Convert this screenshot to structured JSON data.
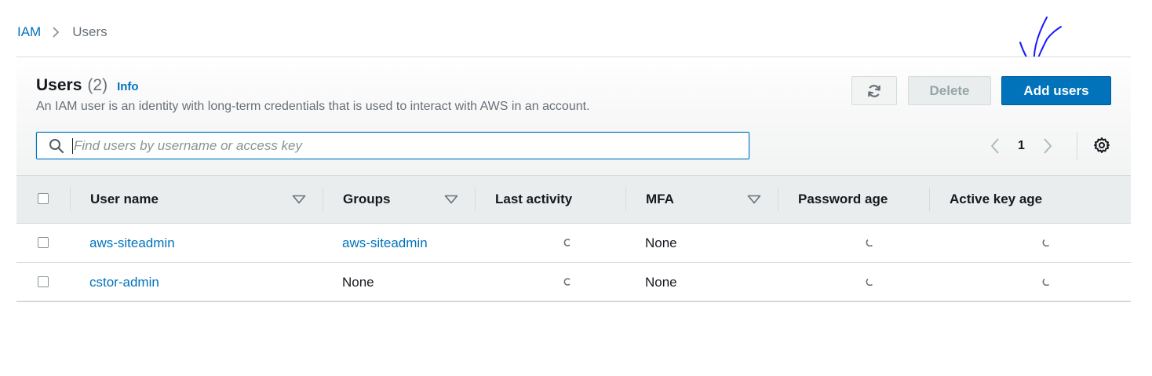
{
  "breadcrumb": {
    "root": "IAM",
    "current": "Users"
  },
  "header": {
    "title": "Users",
    "count": "(2)",
    "info": "Info",
    "description": "An IAM user is an identity with long-term credentials that is used to interact with AWS in an account.",
    "delete_label": "Delete",
    "add_label": "Add users"
  },
  "search": {
    "placeholder": "Find users by username or access key",
    "value": ""
  },
  "pagination": {
    "page": "1"
  },
  "table": {
    "columns": [
      "User name",
      "Groups",
      "Last activity",
      "MFA",
      "Password age",
      "Active key age"
    ],
    "rows": [
      {
        "user_name": "aws-siteadmin",
        "groups": "aws-siteadmin",
        "mfa": "None"
      },
      {
        "user_name": "cstor-admin",
        "groups": "None",
        "mfa": "None"
      }
    ]
  },
  "colors": {
    "accent": "#0073bb",
    "annotation": "#1a1aff"
  },
  "icons": [
    "chevron-right-icon",
    "refresh-icon",
    "search-icon",
    "chevron-left-icon",
    "gear-icon",
    "sort-caret-icon",
    "loading-spinner-icon",
    "checkmark-annotation"
  ]
}
